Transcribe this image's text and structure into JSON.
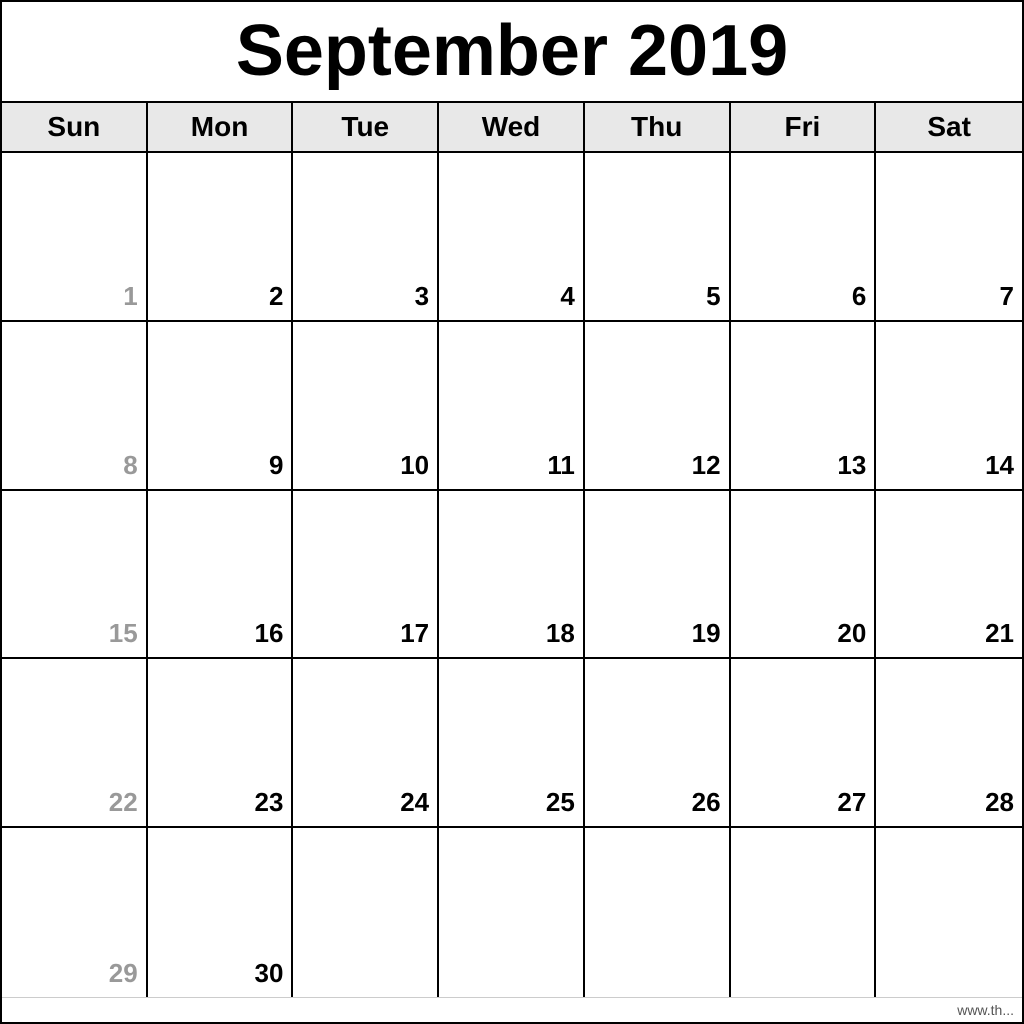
{
  "calendar": {
    "title": "September 2019",
    "header": {
      "days": [
        "Sun",
        "Mon",
        "Tue",
        "Wed",
        "Thu",
        "Fri",
        "Sat"
      ]
    },
    "weeks": [
      [
        {
          "day": 1,
          "outside": true
        },
        {
          "day": 2
        },
        {
          "day": 3
        },
        {
          "day": 4
        },
        {
          "day": 5
        },
        {
          "day": 6
        },
        {
          "day": 7,
          "outside": false
        }
      ],
      [
        {
          "day": 8,
          "outside": true
        },
        {
          "day": 9
        },
        {
          "day": 10
        },
        {
          "day": 11
        },
        {
          "day": 12
        },
        {
          "day": 13
        },
        {
          "day": 14
        }
      ],
      [
        {
          "day": 15,
          "outside": true
        },
        {
          "day": 16
        },
        {
          "day": 17
        },
        {
          "day": 18
        },
        {
          "day": 19
        },
        {
          "day": 20
        },
        {
          "day": 21
        }
      ],
      [
        {
          "day": 22,
          "outside": true
        },
        {
          "day": 23
        },
        {
          "day": 24
        },
        {
          "day": 25
        },
        {
          "day": 26
        },
        {
          "day": 27
        },
        {
          "day": 28
        }
      ],
      [
        {
          "day": 29,
          "outside": true
        },
        {
          "day": 30
        },
        {
          "day": "",
          "empty": true
        },
        {
          "day": "",
          "empty": true
        },
        {
          "day": "",
          "empty": true
        },
        {
          "day": "",
          "empty": true
        },
        {
          "day": "",
          "empty": true
        }
      ]
    ],
    "footer": "www.th..."
  }
}
